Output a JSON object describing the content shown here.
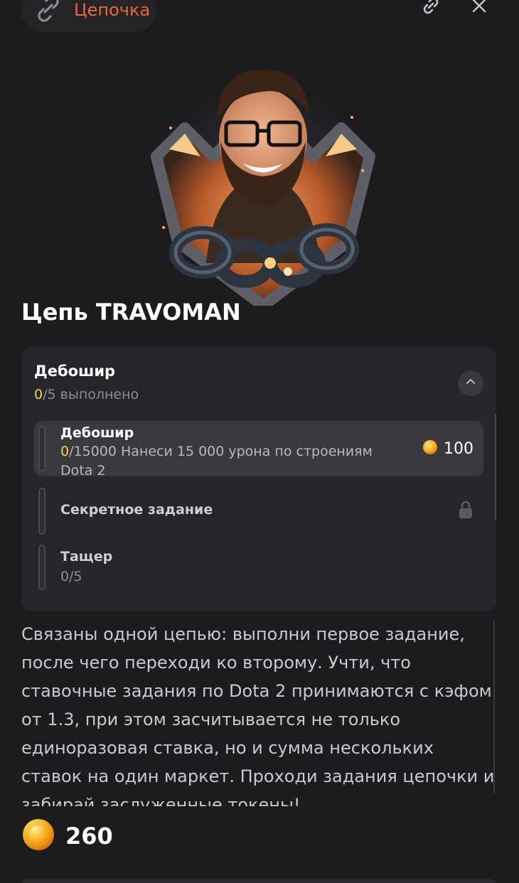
{
  "header": {
    "chain_label": "Цепочка"
  },
  "chain": {
    "title": "Цепь TRAVOMAN"
  },
  "card": {
    "title": "Дебошир",
    "progress_done": "0",
    "progress_rest": "/5 выполнено",
    "tasks": [
      {
        "name": "Дебошир",
        "progress_done": "0",
        "description_rest": "/15000 Нанеси 15 000 урона по строениям Dota 2",
        "reward": "100"
      },
      {
        "name": "Секретное задание"
      },
      {
        "name": "Тащер",
        "progress": "0/5"
      }
    ]
  },
  "description": "Связаны одной цепью: выполни первое задание, после чего переходи ко второму. Учти, что ставочные задания по Dota 2 принимаются с кэфом от 1.3, при этом засчитывается не только единоразовая ставка, но и сумма нескольких ставок на один маркет. Проходи задания цепочки и забирай заслуженные токены!",
  "total_reward": "260",
  "colors": {
    "accent_orange": "#e8693f",
    "progress_yellow": "#f7d54a",
    "background": "#1c1c1e",
    "card": "#26262a"
  },
  "icons": [
    "chain-icon",
    "link-icon",
    "close-icon",
    "chevron-up-icon",
    "coin-icon",
    "lock-icon"
  ]
}
